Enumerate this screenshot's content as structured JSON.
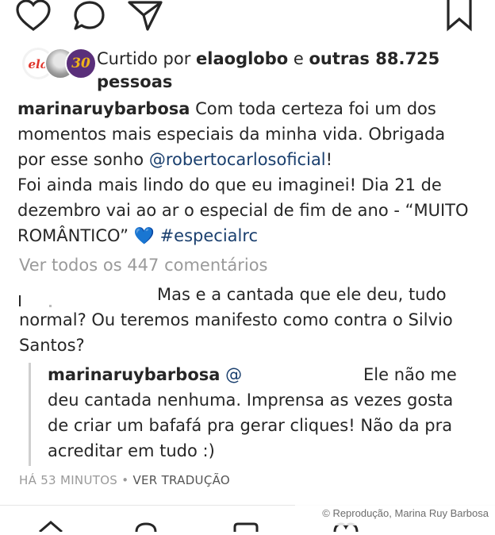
{
  "actions": {
    "like_icon": "heart-outline",
    "comment_icon": "speech-bubble",
    "share_icon": "paper-plane",
    "save_icon": "bookmark"
  },
  "likes": {
    "avatars": [
      {
        "text": "ela",
        "bg": "#ffffff",
        "color": "#e0342b"
      },
      {
        "text": "",
        "bg": "#b9b9b9",
        "color": "#ffffff"
      },
      {
        "text": "30",
        "bg": "#5a2f7a",
        "color": "#f0b31a"
      }
    ],
    "prefix": "Curtido por",
    "user": "elaoglobo",
    "conj": "e",
    "others": "outras 88.725",
    "people": "pessoas"
  },
  "caption": {
    "username": "marinaruybarbosa",
    "line1": "Com toda certeza foi um dos",
    "line2": "momentos mais especiais da minha vida. Obrigada",
    "line3_pre": "por esse sonho",
    "mention": "@robertocarlosoficial",
    "line3_post": "!",
    "line4": "Foi ainda mais lindo do que eu imaginei! Dia 21 de",
    "line5": "dezembro vai ao ar o especial de fim de ano - “MUITO",
    "line6_pre": "ROMÂNTICO”",
    "emoji": "💙",
    "hashtag": "#especialrc"
  },
  "view_all": "Ver todos os 447 comentários",
  "comment": {
    "line1": "Mas e  a cantada que ele deu, tudo",
    "line2": "normal? Ou teremos manifesto como contra o Silvio",
    "line3": "Santos?"
  },
  "reply": {
    "username": "marinaruybarbosa",
    "mention_start": "@",
    "line1_end": "Ele não me",
    "line2": "deu cantada nenhuma. Imprensa as vezes gosta",
    "line3": "de criar um bafafá pra gerar cliques! Não da pra",
    "line4": "acreditar em tudo :)"
  },
  "meta": {
    "time": "HÁ 53 MINUTOS",
    "sep": "•",
    "translate": "VER TRADUÇÃO"
  },
  "credit": "© Reprodução, Marina Ruy Barbosa",
  "colors": {
    "text": "#262626",
    "link": "#1a3f6e",
    "muted": "#9a9a9a",
    "heart_emoji": "#3b9be6"
  }
}
